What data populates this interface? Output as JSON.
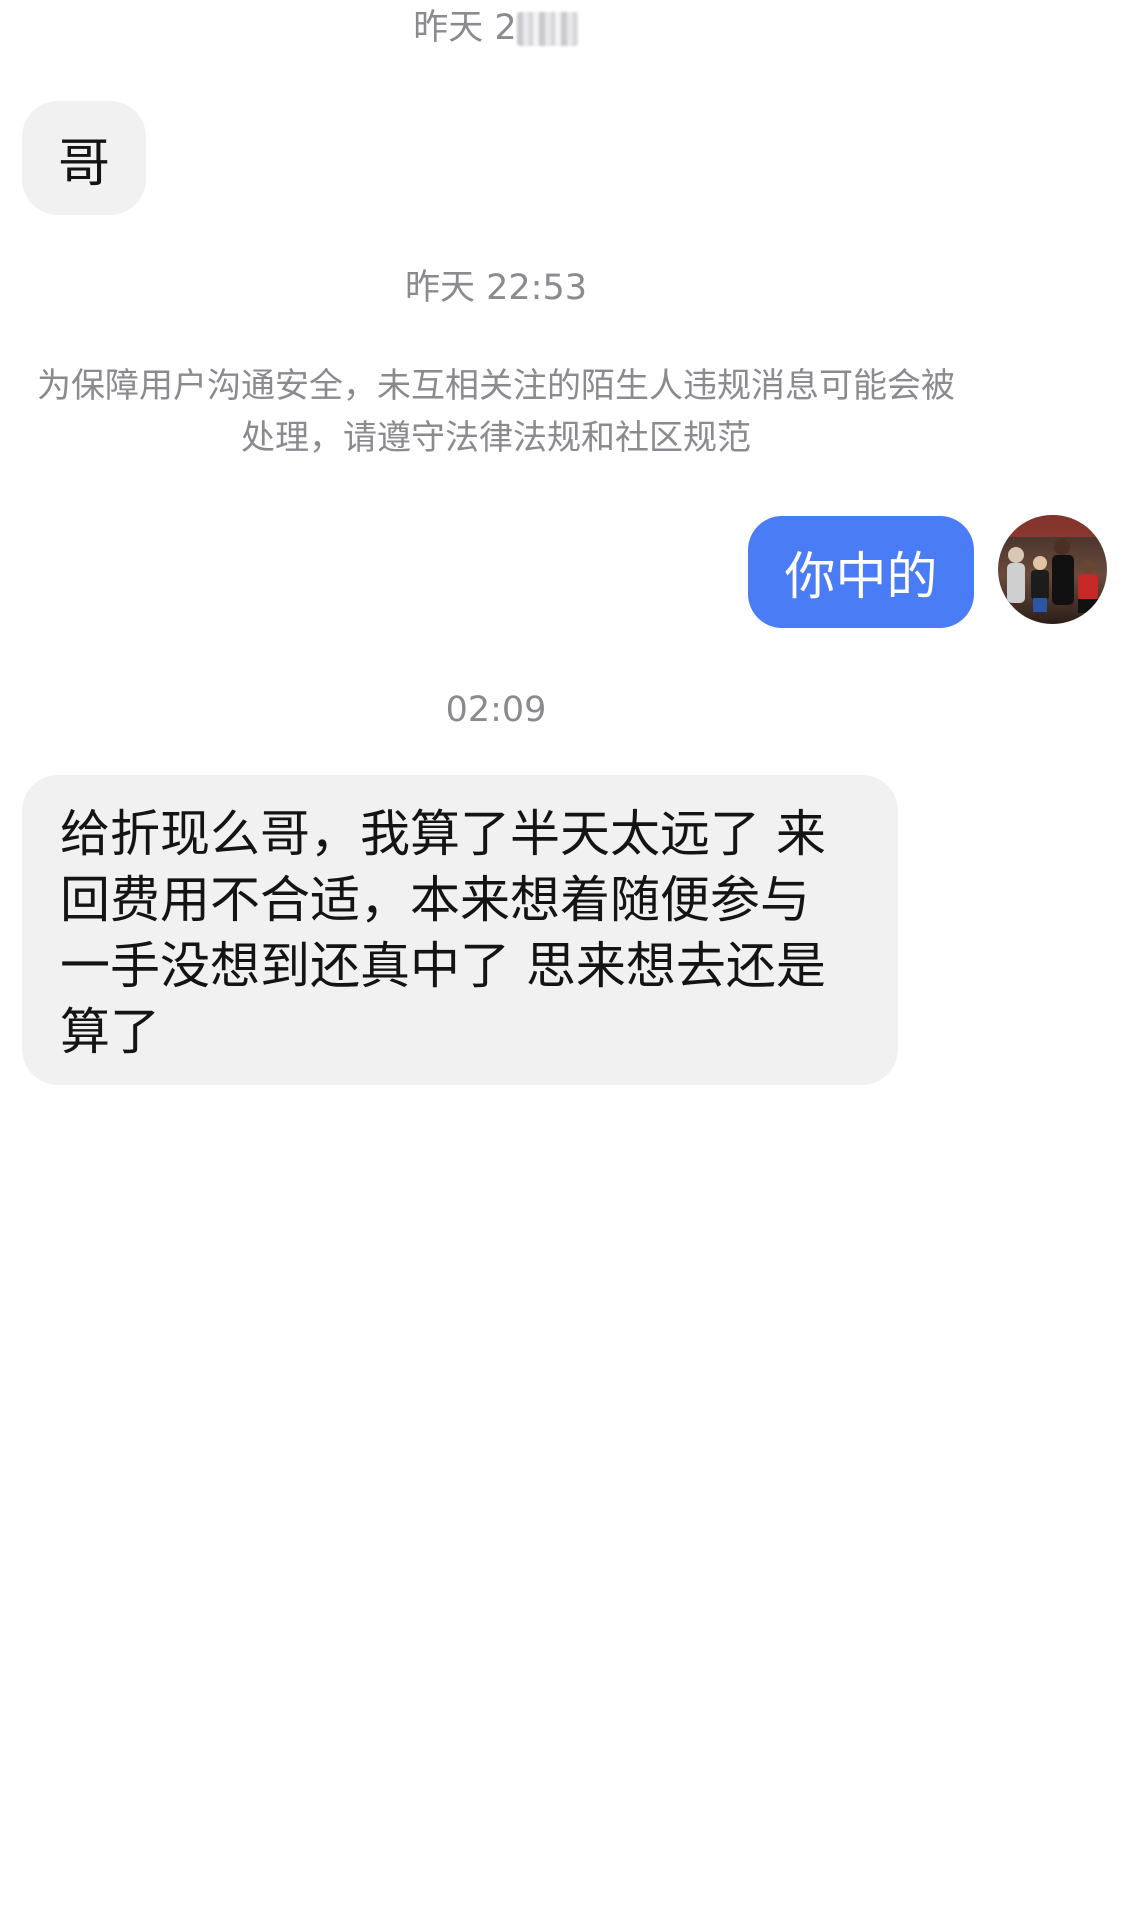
{
  "messages": {
    "timestamp_1_visible": "昨天 2",
    "bubble_in_1": "哥",
    "timestamp_2": "昨天 22:53",
    "notice_line_1": "为保障用户沟通安全，未互相关注的陌生人违规消息可能会被",
    "notice_line_2": "处理，请遵守法律法规和社区规范",
    "bubble_out_1": "你中的",
    "timestamp_3": "02:09",
    "bubble_in_2_lines": [
      "给折现么哥，我算了半天太远了 来",
      "回费用不合适，本来想着随便参与",
      "一手没想到还真中了 思来想去还是",
      "算了"
    ]
  },
  "colors": {
    "incoming_bubble": "#f1f1f2",
    "outgoing_bubble": "#4a7cf6",
    "meta_text": "#8a8a8f",
    "message_text": "#141414"
  }
}
